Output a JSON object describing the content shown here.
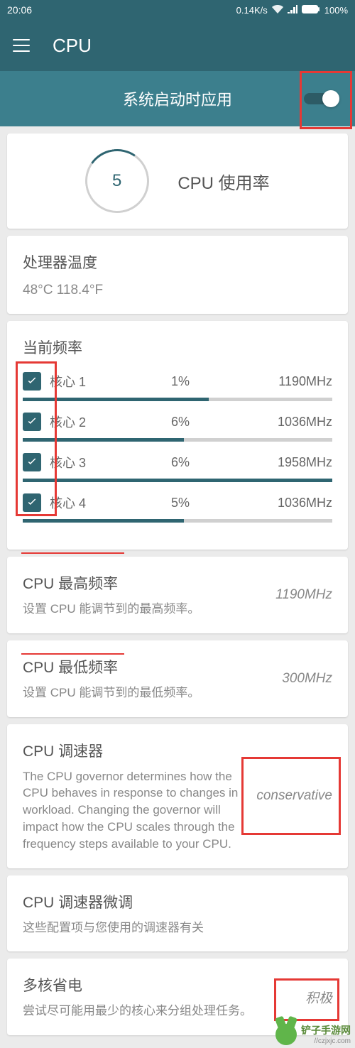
{
  "status": {
    "time": "20:06",
    "speed": "0.14K/s",
    "battery": "100%"
  },
  "header": {
    "title": "CPU"
  },
  "toggle": {
    "label": "系统启动时应用"
  },
  "usage": {
    "value": "5",
    "label": "CPU 使用率"
  },
  "temp": {
    "title": "处理器温度",
    "value": "48°C 118.4°F"
  },
  "freq": {
    "title": "当前频率",
    "cores": [
      {
        "name": "核心 1",
        "pct": "1%",
        "mhz": "1190MHz",
        "bar": 60
      },
      {
        "name": "核心 2",
        "pct": "6%",
        "mhz": "1036MHz",
        "bar": 52
      },
      {
        "name": "核心 3",
        "pct": "6%",
        "mhz": "1958MHz",
        "bar": 100
      },
      {
        "name": "核心 4",
        "pct": "5%",
        "mhz": "1036MHz",
        "bar": 52
      }
    ]
  },
  "max_freq": {
    "title": "CPU 最高频率",
    "desc": "设置 CPU 能调节到的最高频率。",
    "value": "1190MHz"
  },
  "min_freq": {
    "title": "CPU 最低频率",
    "desc": "设置 CPU 能调节到的最低频率。",
    "value": "300MHz"
  },
  "governor": {
    "title": "CPU 调速器",
    "desc": "The CPU governor determines how the CPU behaves in response to changes in workload. Changing the governor will impact how the CPU scales through the frequency steps available to your CPU.",
    "value": "conservative"
  },
  "tuning": {
    "title": "CPU 调速器微调",
    "desc": "这些配置项与您使用的调速器有关"
  },
  "multicore": {
    "title": "多核省电",
    "desc": "尝试尽可能用最少的核心来分组处理任务。",
    "value": "积极"
  },
  "watermark": {
    "cn": "铲子手游网",
    "en": "//czjxjc.com"
  }
}
